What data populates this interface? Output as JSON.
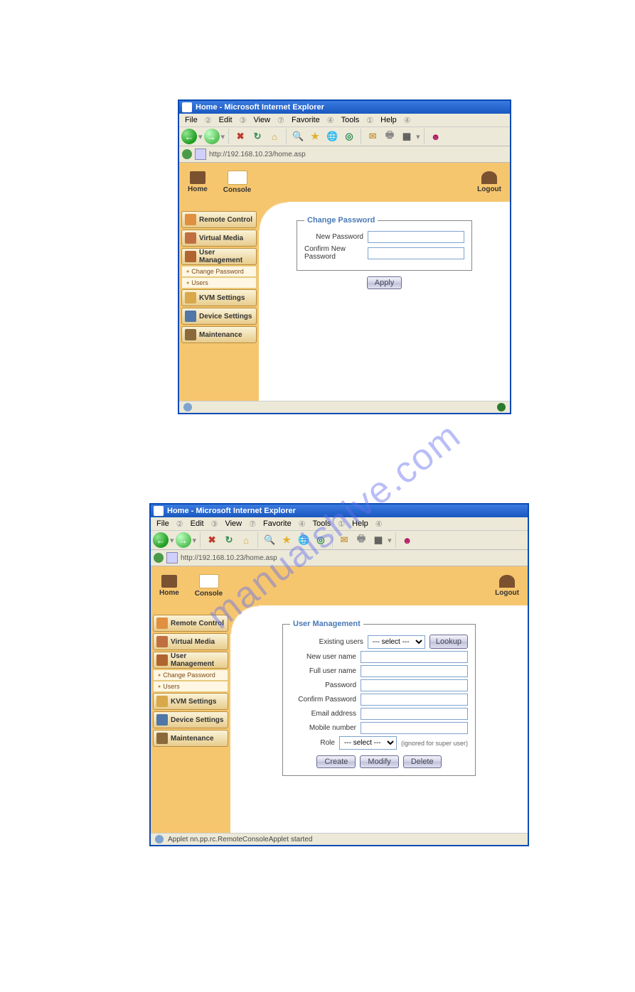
{
  "watermark": "manualshive.com",
  "browser": {
    "title": "Home - Microsoft Internet Explorer",
    "menu": [
      "File",
      "Edit",
      "View",
      "Favorite",
      "Tools",
      "Help"
    ],
    "url": "http://192.168.10.23/home.asp"
  },
  "top_buttons": {
    "home": "Home",
    "console": "Console",
    "logout": "Logout"
  },
  "sidebar": {
    "items": [
      {
        "label": "Remote Control"
      },
      {
        "label": "Virtual Media"
      },
      {
        "label": "User Management"
      },
      {
        "label": "KVM Settings"
      },
      {
        "label": "Device Settings"
      },
      {
        "label": "Maintenance"
      }
    ],
    "subitems": {
      "change_password": "Change Password",
      "users": "Users"
    }
  },
  "screenshot1": {
    "form_title": "Change Password",
    "labels": {
      "new_password": "New Password",
      "confirm_new_password": "Confirm New Password"
    },
    "buttons": {
      "apply": "Apply"
    }
  },
  "screenshot2": {
    "form_title": "User Management",
    "labels": {
      "existing_users": "Existing users",
      "new_user_name": "New user name",
      "full_user_name": "Full user name",
      "password": "Password",
      "confirm_password": "Confirm Password",
      "email_address": "Email address",
      "mobile_number": "Mobile number",
      "role": "Role"
    },
    "select_placeholder": "--- select ---",
    "role_note": "(ignored for super user)",
    "buttons": {
      "lookup": "Lookup",
      "create": "Create",
      "modify": "Modify",
      "delete": "Delete"
    },
    "status": "Applet nn.pp.rc.RemoteConsoleApplet started"
  }
}
